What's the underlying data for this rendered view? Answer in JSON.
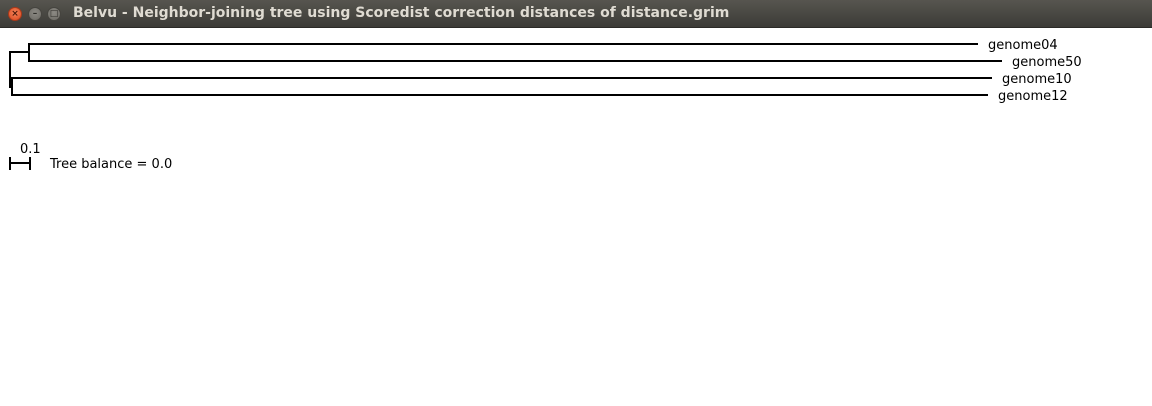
{
  "window": {
    "title": "Belvu - Neighbor-joining tree using Scoredist correction distances of distance.grim",
    "close_glyph": "×",
    "minimize_glyph": "–",
    "maximize_glyph": "□"
  },
  "tree": {
    "leaves": [
      {
        "label": "genome04"
      },
      {
        "label": "genome50"
      },
      {
        "label": "genome10"
      },
      {
        "label": "genome12"
      }
    ],
    "scale_bar_label": "0.1",
    "balance_text": "Tree balance = 0.0",
    "line_color": "#000000"
  }
}
